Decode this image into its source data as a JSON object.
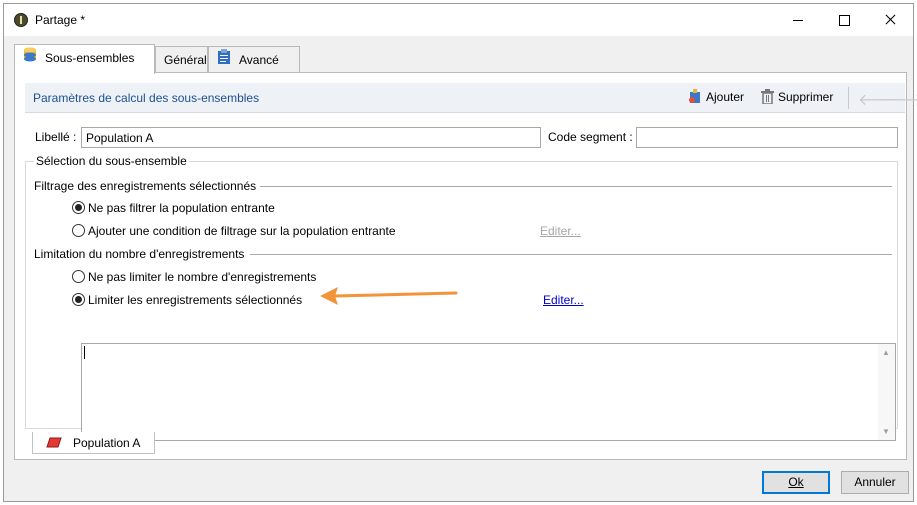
{
  "window": {
    "title": "Partage *"
  },
  "tabs": [
    {
      "label": "Sous-ensembles",
      "icon": "database-icon",
      "active": true
    },
    {
      "label": "Général",
      "active": false
    },
    {
      "label": "Avancé",
      "icon": "clipboard-icon",
      "active": false
    }
  ],
  "toolbar": {
    "title": "Paramètres de calcul des sous-ensembles",
    "add_label": "Ajouter",
    "delete_label": "Supprimer"
  },
  "form": {
    "libelle_label": "Libellé :",
    "libelle_value": "Population A",
    "code_segment_label": "Code segment :",
    "code_segment_value": ""
  },
  "selection": {
    "legend": "Sélection du sous-ensemble",
    "filtering": {
      "heading": "Filtrage des enregistrements sélectionnés",
      "options": [
        {
          "label": "Ne pas filtrer la population entrante",
          "selected": true
        },
        {
          "label": "Ajouter une condition de filtrage sur la population entrante",
          "selected": false
        }
      ],
      "edit_label": "Editer..."
    },
    "limitation": {
      "heading": "Limitation du nombre d'enregistrements",
      "options": [
        {
          "label": "Ne pas limiter le nombre d'enregistrements",
          "selected": false
        },
        {
          "label": "Limiter les enregistrements sélectionnés",
          "selected": true
        }
      ],
      "edit_label": "Editer..."
    }
  },
  "bottom_tab": {
    "label": "Population A"
  },
  "buttons": {
    "ok": "Ok",
    "cancel": "Annuler"
  },
  "colors": {
    "accent": "#0078d7",
    "toolbar_title": "#1c4f93",
    "annotation_arrow": "#f2943a"
  }
}
